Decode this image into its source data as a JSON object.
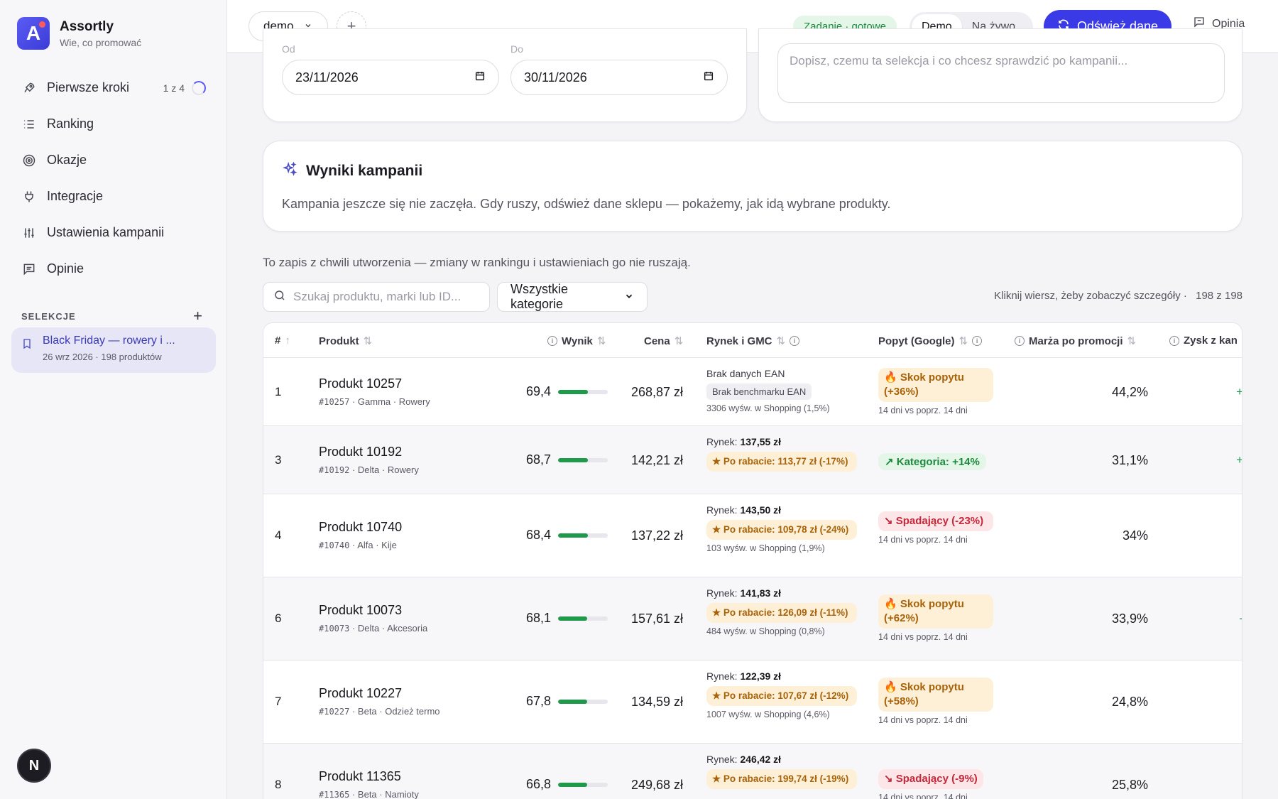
{
  "brand": {
    "name": "Assortly",
    "tagline": "Wie, co promować",
    "logo_letter": "A"
  },
  "nav": [
    {
      "label": "Pierwsze kroki",
      "icon": "rocket-icon",
      "meta": "1 z 4"
    },
    {
      "label": "Ranking",
      "icon": "list-icon"
    },
    {
      "label": "Okazje",
      "icon": "target-icon"
    },
    {
      "label": "Integracje",
      "icon": "plug-icon"
    },
    {
      "label": "Ustawienia kampanii",
      "icon": "sliders-icon"
    },
    {
      "label": "Opinie",
      "icon": "comment-icon"
    }
  ],
  "selections": {
    "heading": "SELEKCJE",
    "item": {
      "title": "Black Friday — rowery i ...",
      "subtitle": "26 wrz 2026 · 198 produktów"
    }
  },
  "fab": {
    "letter": "N"
  },
  "topbar": {
    "store_select": "demo",
    "task_badge": "Zadanie · gotowe",
    "mode_options": [
      "Demo",
      "Na żywo"
    ],
    "mode_selected": "Demo",
    "refresh_label": "Odśwież dane",
    "feedback_label": "Opinia"
  },
  "dates": {
    "from_label": "Od",
    "from_value": "23/11/2026",
    "to_label": "Do",
    "to_value": "30/11/2026"
  },
  "note": {
    "placeholder": "Dopisz, czemu ta selekcja i co chcesz sprawdzić po kampanii..."
  },
  "results": {
    "title": "Wyniki kampanii",
    "text": "Kampania jeszcze się nie zaczęła. Gdy ruszy, odśwież dane sklepu — pokażemy, jak idą wybrane produkty."
  },
  "snapshot_note": "To zapis z chwili utworzenia — zmiany w rankingu i ustawieniach go nie ruszają.",
  "filters": {
    "search_placeholder": "Szukaj produktu, marki lub ID...",
    "category": "Wszystkie kategorie",
    "hint": "Kliknij wiersz, żeby zobaczyć szczegóły ·",
    "count": "198 z 198"
  },
  "columns": {
    "num": "#",
    "product": "Produkt",
    "score": "Wynik",
    "price": "Cena",
    "market": "Rynek i GMC",
    "demand": "Popyt (Google)",
    "margin": "Marża po promocji",
    "profit": "Zysk z kan"
  },
  "rows": [
    {
      "num": "1",
      "name": "Produkt 10257",
      "id": "#10257",
      "meta": "Gamma · Rowery",
      "score": "69,4",
      "score_frac": 0.694,
      "price": "268,87 zł",
      "market_line": "Brak danych EAN",
      "market_value": "",
      "market_tag": "Brak benchmarku EAN",
      "market_tag_kind": "gray",
      "market_note": "3306 wyśw. w Shopping (1,5%)",
      "demand": "🔥 Skok popytu (+36%)",
      "demand_kind": "up",
      "demand_note": "14 dni vs poprz. 14 dni",
      "margin": "44,2%",
      "profit": "+"
    },
    {
      "num": "3",
      "name": "Produkt 10192",
      "id": "#10192",
      "meta": "Delta · Rowery",
      "score": "68,7",
      "score_frac": 0.687,
      "price": "142,21 zł",
      "market_line": "Rynek:",
      "market_value": "137,55 zł",
      "market_tag": "★ Po rabacie: 113,77 zł (-17%)",
      "market_tag_kind": "promo",
      "market_note": "",
      "demand": "↗ Kategoria: +14%",
      "demand_kind": "green",
      "demand_note": "",
      "margin": "31,1%",
      "profit": "+"
    },
    {
      "num": "4",
      "name": "Produkt 10740",
      "id": "#10740",
      "meta": "Alfa · Kije",
      "score": "68,4",
      "score_frac": 0.684,
      "price": "137,22 zł",
      "market_line": "Rynek:",
      "market_value": "143,50 zł",
      "market_tag": "★ Po rabacie: 109,78 zł (-24%)",
      "market_tag_kind": "promo",
      "market_note": "103 wyśw. w Shopping (1,9%)",
      "demand": "↘ Spadający (-23%)",
      "demand_kind": "red",
      "demand_note": "14 dni vs poprz. 14 dni",
      "margin": "34%",
      "profit": ""
    },
    {
      "num": "6",
      "name": "Produkt 10073",
      "id": "#10073",
      "meta": "Delta · Akcesoria",
      "score": "68,1",
      "score_frac": 0.681,
      "price": "157,61 zł",
      "market_line": "Rynek:",
      "market_value": "141,83 zł",
      "market_tag": "★ Po rabacie: 126,09 zł (-11%)",
      "market_tag_kind": "promo",
      "market_note": "484 wyśw. w Shopping (0,8%)",
      "demand": "🔥 Skok popytu (+62%)",
      "demand_kind": "up",
      "demand_note": "14 dni vs poprz. 14 dni",
      "margin": "33,9%",
      "profit": "-"
    },
    {
      "num": "7",
      "name": "Produkt 10227",
      "id": "#10227",
      "meta": "Beta · Odzież termo",
      "score": "67,8",
      "score_frac": 0.678,
      "price": "134,59 zł",
      "market_line": "Rynek:",
      "market_value": "122,39 zł",
      "market_tag": "★ Po rabacie: 107,67 zł (-12%)",
      "market_tag_kind": "promo",
      "market_note": "1007 wyśw. w Shopping (4,6%)",
      "demand": "🔥 Skok popytu (+58%)",
      "demand_kind": "up",
      "demand_note": "14 dni vs poprz. 14 dni",
      "margin": "24,8%",
      "profit": ""
    },
    {
      "num": "8",
      "name": "Produkt 11365",
      "id": "#11365",
      "meta": "Beta · Namioty",
      "score": "66,8",
      "score_frac": 0.668,
      "price": "249,68 zł",
      "market_line": "Rynek:",
      "market_value": "246,42 zł",
      "market_tag": "★ Po rabacie: 199,74 zł (-19%)",
      "market_tag_kind": "promo",
      "market_note": "",
      "demand": "↘ Spadający (-9%)",
      "demand_kind": "red",
      "demand_note": "14 dni vs poprz. 14 dni",
      "margin": "25,8%",
      "profit": ""
    }
  ],
  "colors": {
    "accent": "#3a3ae6",
    "success": "#1f9a4a",
    "warning_bg": "#fdf0d6",
    "danger": "#c4283a"
  }
}
